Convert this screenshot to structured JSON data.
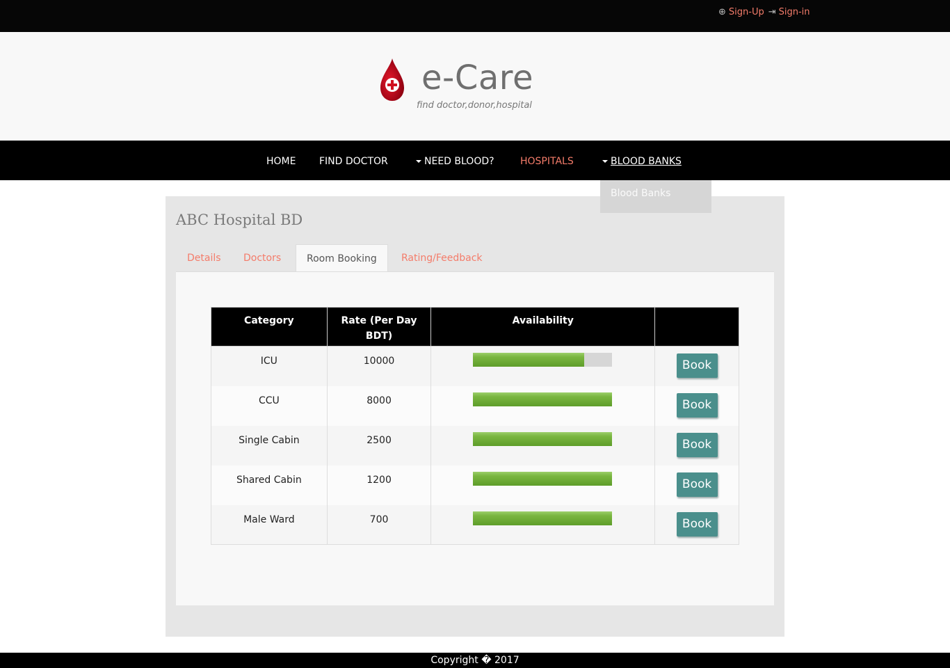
{
  "auth": {
    "signup": "Sign-Up",
    "signin": "Sign-in"
  },
  "brand": {
    "name": "e-Care",
    "tagline": "find doctor,donor,hospital",
    "accent": "#c8102e"
  },
  "nav": {
    "home": "HOME",
    "find_doctor": "FIND DOCTOR",
    "need_blood": "NEED BLOOD?",
    "hospitals": "HOSPITALS",
    "blood_banks": "BLOOD BANKS",
    "dropdown_item": "Blood Banks"
  },
  "hospital": {
    "title": "ABC Hospital BD"
  },
  "tabs": [
    "Details",
    "Doctors",
    "Room Booking",
    "Rating/Feedback"
  ],
  "table": {
    "headers": [
      "Category",
      "Rate (Per Day BDT)",
      "Availability",
      ""
    ],
    "book_label": "Book",
    "rows": [
      {
        "category": "ICU",
        "rate": "10000",
        "availability": 0.8
      },
      {
        "category": "CCU",
        "rate": "8000",
        "availability": 1.0
      },
      {
        "category": "Single Cabin",
        "rate": "2500",
        "availability": 1.0
      },
      {
        "category": "Shared Cabin",
        "rate": "1200",
        "availability": 1.0
      },
      {
        "category": "Male Ward",
        "rate": "700",
        "availability": 1.0
      }
    ]
  },
  "footer": {
    "text": "Copyright � 2017"
  },
  "colors": {
    "link": "#f47c6a",
    "button": "#4a8f8c",
    "bar": "#7ab640"
  }
}
